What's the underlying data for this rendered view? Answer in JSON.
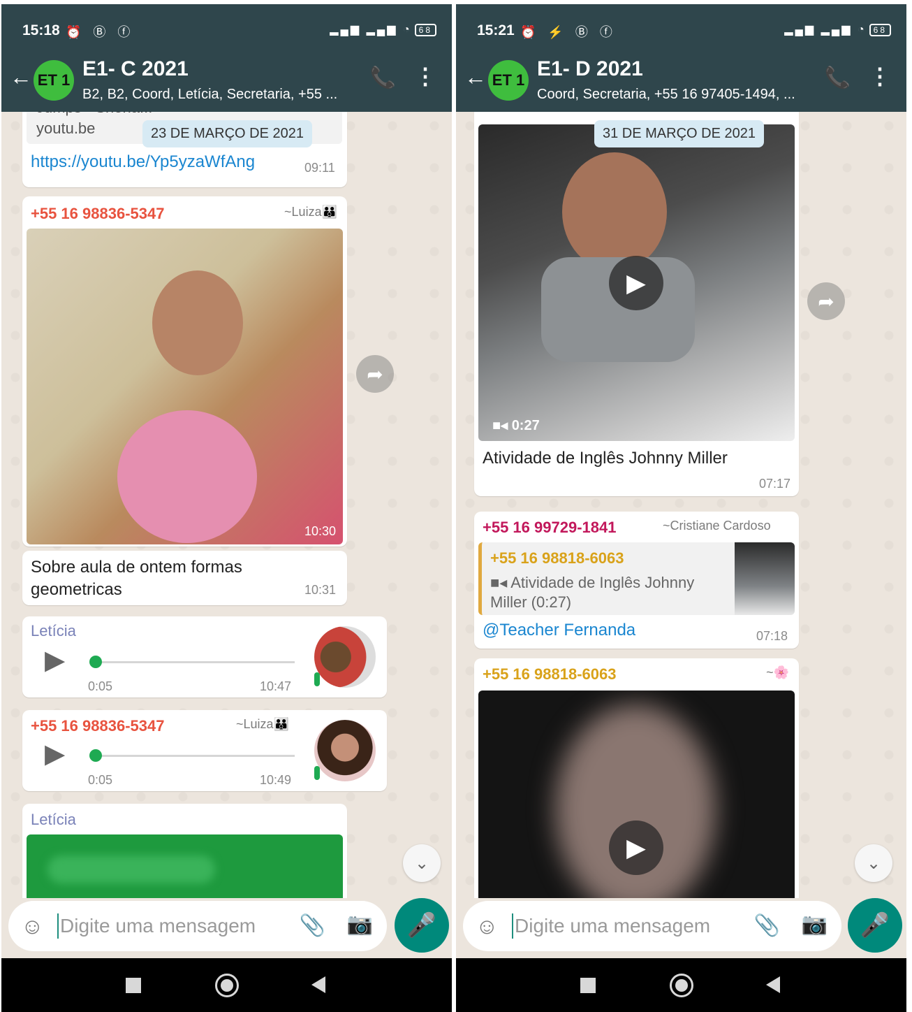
{
  "left": {
    "status": {
      "time": "15:18",
      "icons_left": "⏰ Ⓑ ⓕ",
      "battery": "68"
    },
    "header": {
      "avatar": "ET 1",
      "title": "E1- C 2021",
      "subtitle": "B2, B2, Coord, Letícia, Secretaria, +55 ..."
    },
    "link_preview": {
      "clipped_title": "Jumps · Shena...",
      "domain": "youtu.be",
      "url": "https://youtu.be/Yp5yzaWfAng",
      "time": "09:11"
    },
    "date_chip": "23 DE MARÇO DE 2021",
    "photo_msg": {
      "sender": "+55 16 98836-5347",
      "pushname": "~Luiza👪",
      "time": "10:30"
    },
    "caption_msg": {
      "text": "Sobre aula de ontem formas geometricas",
      "time": "10:31"
    },
    "voice1": {
      "sender": "Letícia",
      "duration": "0:05",
      "time": "10:47"
    },
    "voice2": {
      "sender": "+55 16 98836-5347",
      "pushname": "~Luiza👪",
      "duration": "0:05",
      "time": "10:49"
    },
    "last_msg": {
      "sender": "Letícia"
    },
    "composer": {
      "placeholder": "Digite uma mensagem"
    }
  },
  "right": {
    "status": {
      "time": "15:21",
      "icons_left": "⏰ ⚡ Ⓑ ⓕ",
      "battery": "68"
    },
    "header": {
      "avatar": "ET 1",
      "title": "E1- D 2021",
      "subtitle": "Coord, Secretaria, +55 16 97405-1494, ..."
    },
    "date_chip": "31 DE MARÇO DE 2021",
    "video_msg": {
      "duration": "0:27",
      "caption": "Atividade de Inglês Johnny Miller",
      "time": "07:17"
    },
    "reply_msg": {
      "sender": "+55 16 99729-1841",
      "pushname": "~Cristiane Cardoso",
      "quote_sender": "+55 16 98818-6063",
      "quote_text": "Atividade de Inglês Johnny Miller (0:27)",
      "text": "@Teacher Fernanda",
      "time": "07:18"
    },
    "video2_msg": {
      "sender": "+55 16 98818-6063",
      "pushname": "~🌸"
    },
    "composer": {
      "placeholder": "Digite uma mensagem"
    }
  },
  "colors": {
    "header": "#2f464c",
    "chat_bg": "#ece5dd",
    "accent": "#00897b",
    "link": "#1a86d0",
    "sender_red": "#e8533f",
    "sender_purple": "#7a82b8",
    "sender_magenta": "#c2185b",
    "sender_amber": "#d9a21a"
  }
}
